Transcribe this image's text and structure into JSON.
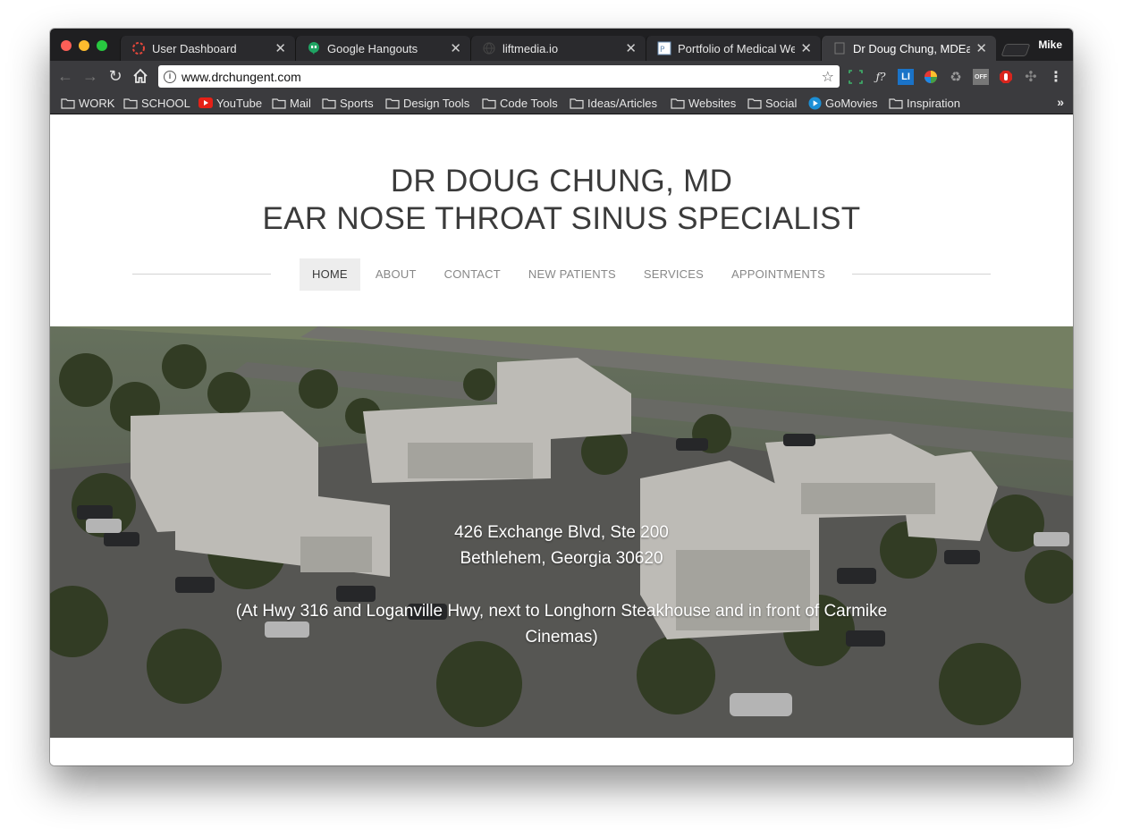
{
  "browser": {
    "tabs": [
      {
        "title": "User Dashboard",
        "icon": "dashboard-icon"
      },
      {
        "title": "Google Hangouts",
        "icon": "hangouts-icon"
      },
      {
        "title": "liftmedia.io",
        "icon": "globe-icon"
      },
      {
        "title": "Portfolio of Medical Web",
        "icon": "portfolio-icon"
      },
      {
        "title": "Dr Doug Chung, MDEar N",
        "icon": "page-icon"
      }
    ],
    "profile_name": "Mike",
    "address_bar": {
      "url": "www.drchungent.com"
    },
    "bookmarks": [
      {
        "label": "WORK",
        "icon": "folder-icon"
      },
      {
        "label": "SCHOOL",
        "icon": "folder-icon"
      },
      {
        "label": "YouTube",
        "icon": "youtube-icon"
      },
      {
        "label": "Mail",
        "icon": "folder-icon"
      },
      {
        "label": "Sports",
        "icon": "folder-icon"
      },
      {
        "label": "Design Tools",
        "icon": "folder-icon"
      },
      {
        "label": "Code Tools",
        "icon": "folder-icon"
      },
      {
        "label": "Ideas/Articles",
        "icon": "folder-icon"
      },
      {
        "label": "Websites",
        "icon": "folder-icon"
      },
      {
        "label": "Social",
        "icon": "folder-icon"
      },
      {
        "label": "GoMovies",
        "icon": "gomovies-icon"
      },
      {
        "label": "Inspiration",
        "icon": "folder-icon"
      }
    ],
    "bookmarks_overflow": "»"
  },
  "site": {
    "title_line1": "DR DOUG CHUNG, MD",
    "title_line2": "EAR NOSE THROAT SINUS SPECIALIST",
    "nav": [
      {
        "label": "HOME",
        "active": true
      },
      {
        "label": "ABOUT",
        "active": false
      },
      {
        "label": "CONTACT",
        "active": false
      },
      {
        "label": "NEW PATIENTS",
        "active": false
      },
      {
        "label": "SERVICES",
        "active": false
      },
      {
        "label": "APPOINTMENTS",
        "active": false
      }
    ],
    "hero": {
      "address_line1": "426 Exchange Blvd, Ste 200",
      "address_line2": "Bethlehem, Georgia 30620",
      "directions": "(At Hwy 316 and Loganville Hwy, next to Longhorn Steakhouse and in front of Carmike Cinemas)"
    }
  },
  "colors": {
    "tabstrip_bg": "#1f1f21",
    "toolbar_bg": "#3b3b3e",
    "title_text": "#3b3b3b",
    "nav_inactive": "#888888",
    "nav_active_bg": "#ededed"
  }
}
